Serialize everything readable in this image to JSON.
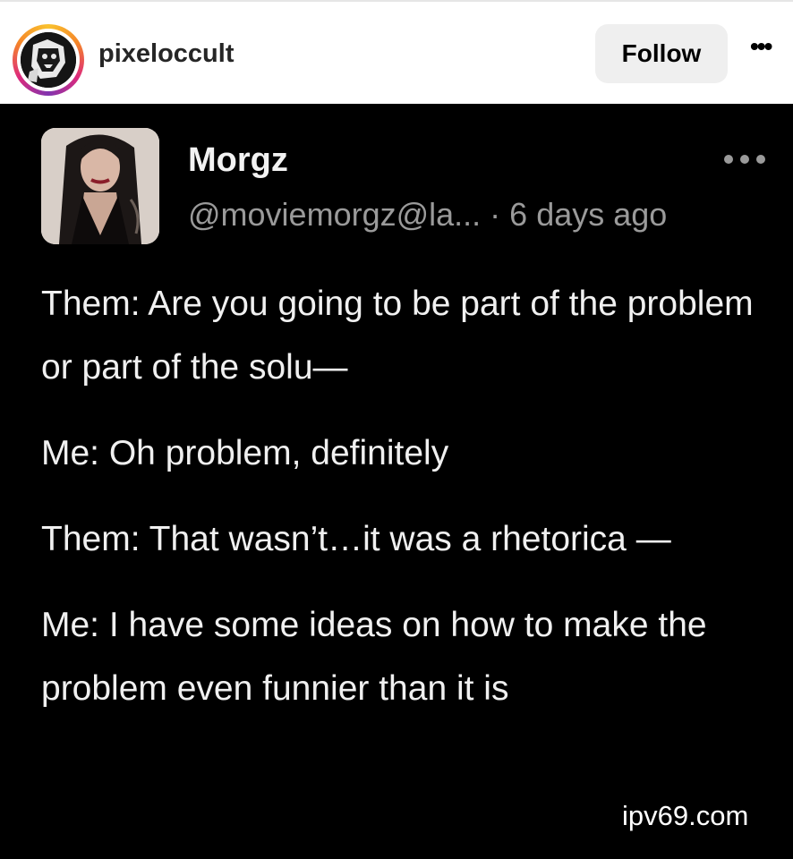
{
  "header": {
    "username": "pixeloccult",
    "follow_label": "Follow",
    "more_icon": "more-horizontal-icon"
  },
  "post": {
    "author_name": "Morgz",
    "handle": "@moviemorgz@la...",
    "separator": " · ",
    "time_ago": "6 days ago",
    "more_icon": "more-horizontal-icon",
    "paragraphs": [
      "Them: Are you going to be part of the problem or part of the solu—",
      "Me: Oh problem, definitely",
      "Them: That wasn’t…it was a rhetorica —",
      "Me: I have some ideas on how to make the problem even funnier than it is"
    ]
  },
  "watermark": "ipv69.com",
  "colors": {
    "post_background": "#000000",
    "header_background": "#ffffff",
    "follow_button": "#efefef",
    "handle_gray": "#9a9a9a"
  }
}
